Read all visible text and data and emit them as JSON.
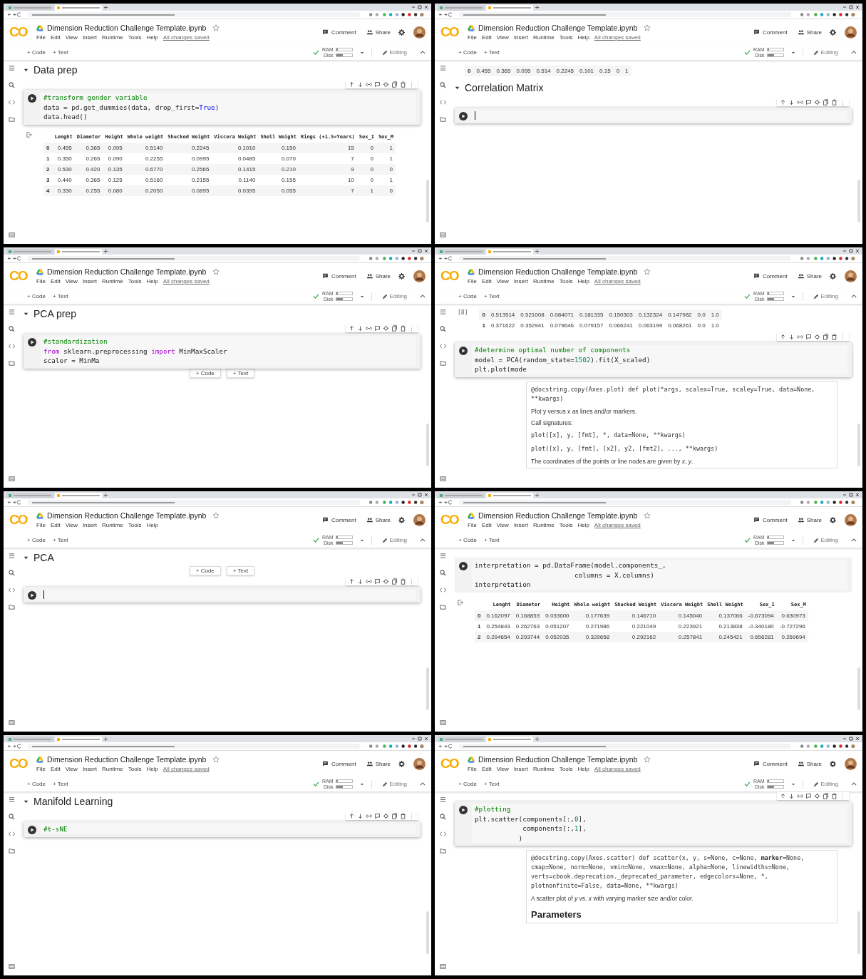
{
  "panels": [
    {
      "header": {
        "logo": "CO",
        "title": "Dimension Reduction Challenge Template.ipynb",
        "menu": [
          "File",
          "Edit",
          "View",
          "Insert",
          "Runtime",
          "Tools",
          "Help"
        ],
        "saved": "All changes saved",
        "comment": "Comment",
        "share": "Share"
      },
      "toolbar": {
        "add_code": "+ Code",
        "add_text": "+ Text",
        "ram": "RAM",
        "disk": "Disk",
        "editing": "Editing"
      },
      "blocks": [
        {
          "kind": "heading",
          "text": "Data prep",
          "expanded": true
        },
        {
          "kind": "code",
          "toolbar": true,
          "lines": [
            [
              {
                "s": "#transform gender variable",
                "kind": "comment"
              }
            ],
            [
              {
                "s": "data = pd.get_dummies(data, drop_first=",
                "kind": "plain"
              },
              {
                "s": "True",
                "kind": "constant"
              },
              {
                "s": ")",
                "kind": "plain"
              }
            ],
            [
              {
                "s": "data.head()",
                "kind": "plain"
              }
            ]
          ]
        },
        {
          "kind": "table",
          "output_icon": true,
          "columns": [
            "Lenght",
            "Diameter",
            "Height",
            "Whole weight",
            "Shucked Weight",
            "Viscera Weight",
            "Shell Weight",
            "Rings (+1.5=Years)",
            "Sex_I",
            "Sex_M"
          ],
          "rows": [
            {
              "index": "0",
              "cells": [
                "0.455",
                "0.365",
                "0.095",
                "0.5140",
                "0.2245",
                "0.1010",
                "0.150",
                "15",
                "0",
                "1"
              ]
            },
            {
              "index": "1",
              "cells": [
                "0.350",
                "0.265",
                "0.090",
                "0.2255",
                "0.0995",
                "0.0485",
                "0.070",
                "7",
                "0",
                "1"
              ]
            },
            {
              "index": "2",
              "cells": [
                "0.530",
                "0.420",
                "0.135",
                "0.6770",
                "0.2565",
                "0.1415",
                "0.210",
                "9",
                "0",
                "0"
              ]
            },
            {
              "index": "3",
              "cells": [
                "0.440",
                "0.365",
                "0.125",
                "0.5160",
                "0.2155",
                "0.1140",
                "0.155",
                "10",
                "0",
                "1"
              ]
            },
            {
              "index": "4",
              "cells": [
                "0.330",
                "0.255",
                "0.080",
                "0.2050",
                "0.0895",
                "0.0395",
                "0.055",
                "7",
                "1",
                "0"
              ]
            }
          ]
        }
      ]
    },
    {
      "header": {
        "logo": "CO",
        "title": "Dimension Reduction Challenge Template.ipynb",
        "menu": [
          "File",
          "Edit",
          "View",
          "Insert",
          "Runtime",
          "Tools",
          "Help"
        ],
        "saved": "All changes saved",
        "comment": "Comment",
        "share": "Share"
      },
      "toolbar": {
        "add_code": "+ Code",
        "add_text": "+ Text",
        "ram": "RAM",
        "disk": "Disk",
        "editing": "Editing"
      },
      "blocks": [
        {
          "kind": "table",
          "output_icon": false,
          "rows": [
            {
              "index": "0",
              "cells": [
                "0.455",
                "0.365",
                "0.095",
                "0.514",
                "0.2245",
                "0.101",
                "0.15",
                "0",
                "1"
              ]
            }
          ]
        },
        {
          "kind": "heading",
          "text": "Correlation Matrix",
          "expanded": true
        },
        {
          "kind": "code",
          "toolbar": true
        }
      ]
    },
    {
      "header": {
        "logo": "CO",
        "title": "Dimension Reduction Challenge Template.ipynb",
        "menu": [
          "File",
          "Edit",
          "View",
          "Insert",
          "Runtime",
          "Tools",
          "Help"
        ],
        "saved": "All changes saved",
        "comment": "Comment",
        "share": "Share"
      },
      "toolbar": {
        "add_code": "+ Code",
        "add_text": "+ Text",
        "ram": "RAM",
        "disk": "Disk",
        "editing": "Editing"
      },
      "blocks": [
        {
          "kind": "heading",
          "text": "PCA prep",
          "expanded": true
        },
        {
          "kind": "code",
          "toolbar": true,
          "lines": [
            [
              {
                "s": "#standardization",
                "kind": "comment"
              }
            ],
            [
              {
                "s": "from",
                "kind": "keyword"
              },
              {
                "s": " sklearn.preprocessing ",
                "kind": "plain"
              },
              {
                "s": "import",
                "kind": "keyword"
              },
              {
                "s": " MinMaxScaler",
                "kind": "plain"
              }
            ],
            [
              {
                "s": "scaler = MinMa",
                "kind": "plain"
              }
            ]
          ]
        },
        {
          "kind": "add_bar",
          "code": "+ Code",
          "text": "+ Text"
        }
      ]
    },
    {
      "header": {
        "logo": "CO",
        "title": "Dimension Reduction Challenge Template.ipynb",
        "menu": [
          "File",
          "Edit",
          "View",
          "Insert",
          "Runtime",
          "Tools",
          "Help"
        ],
        "saved": "All changes saved",
        "comment": "Comment",
        "share": "Share"
      },
      "toolbar": {
        "add_code": "+ Code",
        "add_text": "+ Text",
        "ram": "RAM",
        "disk": "Disk",
        "editing": "Editing"
      },
      "blocks": [
        {
          "kind": "table",
          "output_icon": false,
          "exec_count": "[8]",
          "rows": [
            {
              "index": "0",
              "cells": [
                "0.513514",
                "0.521008",
                "0.084071",
                "0.181335",
                "0.150303",
                "0.132324",
                "0.147982",
                "0.0",
                "1.0"
              ]
            },
            {
              "index": "1",
              "cells": [
                "0.371622",
                "0.352941",
                "0.079646",
                "0.079157",
                "0.066241",
                "0.063199",
                "0.068261",
                "0.0",
                "1.0"
              ]
            }
          ]
        },
        {
          "kind": "code",
          "toolbar": true,
          "lines": [
            [
              {
                "s": "#determine optimal number of components",
                "kind": "comment"
              }
            ],
            [
              {
                "s": "model = PCA(random_state=",
                "kind": "plain"
              },
              {
                "s": "1502",
                "kind": "number"
              },
              {
                "s": ").fit(X_scaled)",
                "kind": "plain"
              }
            ],
            [
              {
                "s": "plt.plot(mode",
                "kind": "plain"
              }
            ]
          ]
        },
        {
          "kind": "docstring",
          "items": [
            {
              "kind": "signature",
              "text": "@docstring.copy(Axes.plot) def plot(*args, scalex=True, scaley=True, data=None, **kwargs)"
            },
            {
              "kind": "paragraph",
              "text": "Plot y versus x as lines and/or markers."
            },
            {
              "kind": "paragraph",
              "text": "Call signatures:"
            },
            {
              "kind": "code",
              "text": "plot([x], y, [fmt], *, data=None, **kwargs)"
            },
            {
              "kind": "code",
              "text": "plot([x], y, [fmt], [x2], y2, [fmt2], ..., **kwargs)"
            },
            {
              "kind": "paragraph",
              "text": "The coordinates of the points or line nodes are given by *x*, *y*."
            }
          ]
        }
      ]
    },
    {
      "header": {
        "logo": "CO",
        "title": "Dimension Reduction Challenge Template.ipynb",
        "menu": [
          "File",
          "Edit",
          "View",
          "Insert",
          "Runtime",
          "Tools",
          "Help"
        ],
        "comment": "Comment",
        "share": "Share"
      },
      "toolbar": {
        "add_code": "+ Code",
        "add_text": "+ Text",
        "ram": "RAM",
        "disk": "Disk",
        "editing": "Editing"
      },
      "blocks": [
        {
          "kind": "heading",
          "text": "PCA",
          "expanded": true
        },
        {
          "kind": "add_bar",
          "code": "+ Code",
          "text": "+ Text"
        },
        {
          "kind": "code",
          "toolbar": true
        }
      ]
    },
    {
      "header": {
        "logo": "CO",
        "title": "Dimension Reduction Challenge Template.ipynb",
        "menu": [
          "File",
          "Edit",
          "View",
          "Insert",
          "Runtime",
          "Tools",
          "Help"
        ],
        "saved": "All changes saved",
        "comment": "Comment",
        "share": "Share"
      },
      "toolbar": {
        "add_code": "+ Code",
        "add_text": "+ Text",
        "ram": "RAM",
        "disk": "Disk",
        "editing": "Editing"
      },
      "blocks": [
        {
          "kind": "code",
          "toolbar": false,
          "lines": [
            [
              {
                "s": "interpretation = pd.DataFrame(model.components_,",
                "kind": "plain"
              }
            ],
            [
              {
                "s": "                         columns = X.columns)",
                "kind": "plain"
              }
            ],
            [
              {
                "s": "interpretation",
                "kind": "plain"
              }
            ]
          ]
        },
        {
          "kind": "table",
          "output_icon": true,
          "columns": [
            "Lenght",
            "Diameter",
            "Height",
            "Whole weight",
            "Shucked Weight",
            "Viscera Weight",
            "Shell Weight",
            "Sex_I",
            "Sex_M"
          ],
          "rows": [
            {
              "index": "0",
              "cells": [
                "0.162097",
                "0.168853",
                "0.033600",
                "0.177639",
                "0.146710",
                "0.145040",
                "0.137066",
                "-0.673094",
                "0.630973"
              ]
            },
            {
              "index": "1",
              "cells": [
                "0.254843",
                "0.262763",
                "0.051207",
                "0.271986",
                "0.221049",
                "0.223921",
                "0.213838",
                "-0.340180",
                "-0.727296"
              ]
            },
            {
              "index": "2",
              "cells": [
                "0.294654",
                "0.293744",
                "0.052035",
                "0.329658",
                "0.292162",
                "0.257841",
                "0.245421",
                "0.656281",
                "0.269694"
              ]
            }
          ]
        }
      ]
    },
    {
      "header": {
        "logo": "CO",
        "title": "Dimension Reduction Challenge Template.ipynb",
        "menu": [
          "File",
          "Edit",
          "View",
          "Insert",
          "Runtime",
          "Tools",
          "Help"
        ],
        "saved": "All changes saved",
        "comment": "Comment",
        "share": "Share"
      },
      "toolbar": {
        "add_code": "+ Code",
        "add_text": "+ Text",
        "ram": "RAM",
        "disk": "Disk",
        "editing": "Editing"
      },
      "blocks": [
        {
          "kind": "heading",
          "text": "Manifold Learning",
          "expanded": true
        },
        {
          "kind": "code",
          "toolbar": true,
          "lines": [
            [
              {
                "s": "#t-sNE",
                "kind": "comment"
              }
            ]
          ]
        }
      ]
    },
    {
      "header": {
        "logo": "CO",
        "title": "Dimension Reduction Challenge Template.ipynb",
        "menu": [
          "File",
          "Edit",
          "View",
          "Insert",
          "Runtime",
          "Tools",
          "Help"
        ],
        "saved": "All changes saved",
        "comment": "Comment",
        "share": "Share"
      },
      "toolbar": {
        "add_code": "+ Code",
        "add_text": "+ Text",
        "ram": "RAM",
        "disk": "Disk",
        "editing": "Editing"
      },
      "blocks": [
        {
          "kind": "code",
          "toolbar": true,
          "lines": [
            [
              {
                "s": "#plotting",
                "kind": "comment"
              }
            ],
            [
              {
                "s": "plt.scatter(components[:,",
                "kind": "plain"
              },
              {
                "s": "0",
                "kind": "number"
              },
              {
                "s": "],",
                "kind": "plain"
              }
            ],
            [
              {
                "s": "            components[:,",
                "kind": "plain"
              },
              {
                "s": "1",
                "kind": "number"
              },
              {
                "s": "],",
                "kind": "plain"
              }
            ],
            [
              {
                "s": "           )",
                "kind": "plain"
              }
            ]
          ]
        },
        {
          "kind": "docstring",
          "items": [
            {
              "kind": "signature",
              "text": "@docstring.copy(Axes.scatter) def scatter(x, y, s=None, c=None, **marker**=None, cmap=None, norm=None, vmin=None, vmax=None, alpha=None, linewidths=None, verts=cbook.deprecation._deprecated_parameter, edgecolors=None, *, plotnonfinite=False, data=None, **kwargs)"
            },
            {
              "kind": "paragraph",
              "text": "A scatter plot of *y* vs. *x* with varying marker size and/or color."
            },
            {
              "kind": "heading",
              "text": "**Parameters**"
            }
          ]
        }
      ]
    }
  ]
}
